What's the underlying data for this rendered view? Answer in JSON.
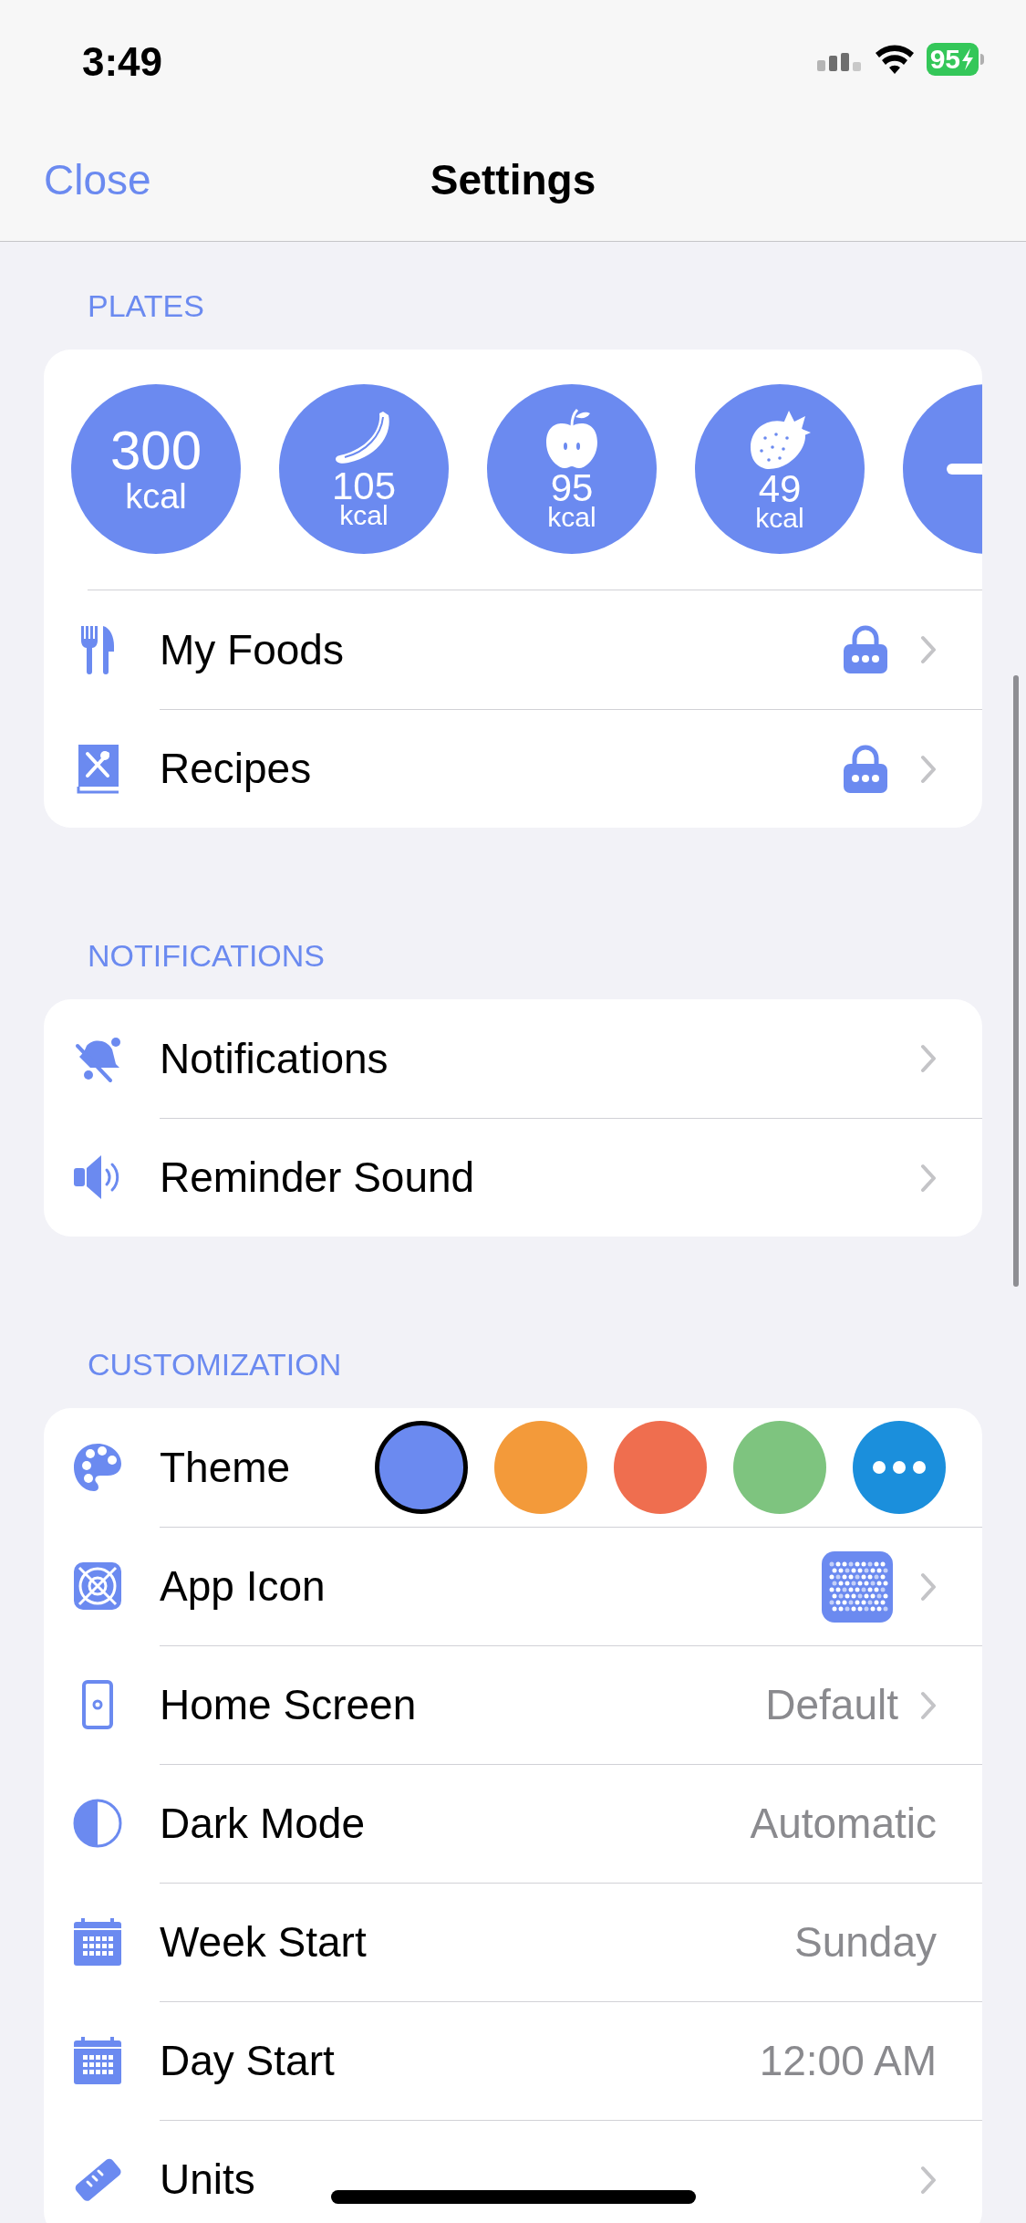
{
  "status_bar": {
    "time": "3:49",
    "battery": "95"
  },
  "nav": {
    "back": "Close",
    "title": "Settings"
  },
  "sections": [
    {
      "header": "PLATES",
      "plates": [
        {
          "kind": "total",
          "value": "300",
          "unit": "kcal"
        },
        {
          "kind": "food",
          "value": "105",
          "unit": "kcal"
        },
        {
          "kind": "food",
          "value": "95",
          "unit": "kcal"
        },
        {
          "kind": "food",
          "value": "49",
          "unit": "kcal"
        },
        {
          "kind": "add"
        }
      ],
      "rows": [
        {
          "kind": "link",
          "label": "My Foods",
          "locked": true,
          "chevron": true
        },
        {
          "kind": "link",
          "label": "Recipes",
          "locked": true,
          "chevron": true
        }
      ]
    },
    {
      "header": "NOTIFICATIONS",
      "rows": [
        {
          "kind": "link",
          "label": "Notifications",
          "locked": false,
          "chevron": true
        },
        {
          "kind": "link",
          "label": "Reminder Sound",
          "locked": false,
          "chevron": true
        }
      ]
    },
    {
      "header": "CUSTOMIZATION",
      "rows": [
        {
          "kind": "theme",
          "label": "Theme",
          "swatches": [
            {
              "kind": "color",
              "color": "#6b8af0",
              "selected": true
            },
            {
              "kind": "color",
              "color": "#f39a3a",
              "selected": false
            },
            {
              "kind": "color",
              "color": "#ef6e4f",
              "selected": false
            },
            {
              "kind": "color",
              "color": "#7ec47f",
              "selected": false
            },
            {
              "kind": "more",
              "color": "#1b8fdc",
              "selected": false
            }
          ]
        },
        {
          "kind": "app_icon",
          "label": "App Icon",
          "locked": false,
          "chevron": true
        },
        {
          "kind": "link",
          "label": "Home Screen",
          "value": "Default",
          "locked": false,
          "chevron": true
        },
        {
          "kind": "link",
          "label": "Dark Mode",
          "value": "Automatic",
          "locked": false,
          "chevron": false
        },
        {
          "kind": "link",
          "label": "Week Start",
          "value": "Sunday",
          "locked": false,
          "chevron": false
        },
        {
          "kind": "link",
          "label": "Day Start",
          "value": "12:00 AM",
          "locked": false,
          "chevron": false
        },
        {
          "kind": "link",
          "label": "Units",
          "locked": false,
          "chevron": true
        }
      ]
    }
  ]
}
